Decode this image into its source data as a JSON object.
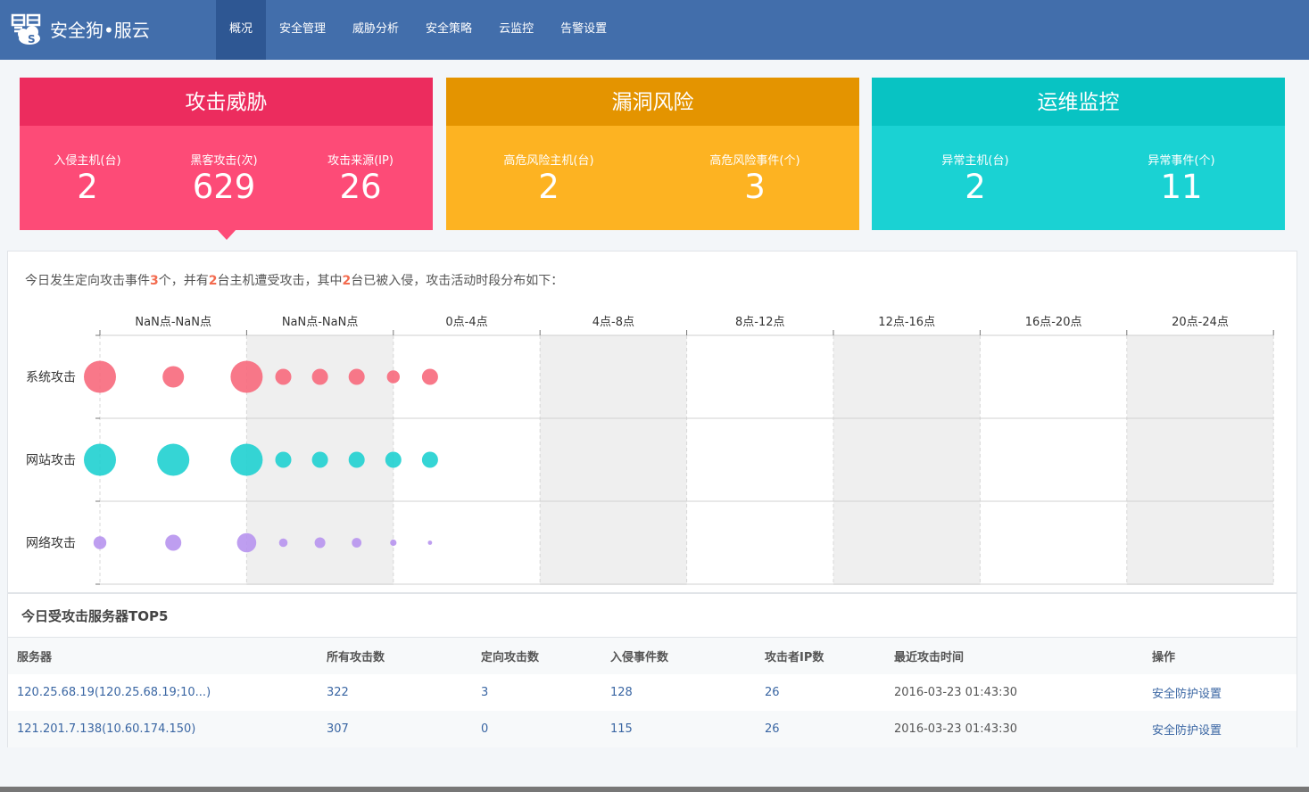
{
  "header": {
    "brand": "安全狗•服云",
    "logo_icon": "safedog-logo-icon",
    "nav": [
      {
        "label": "概况",
        "active": true
      },
      {
        "label": "安全管理",
        "active": false
      },
      {
        "label": "威胁分析",
        "active": false
      },
      {
        "label": "安全策略",
        "active": false
      },
      {
        "label": "云监控",
        "active": false
      },
      {
        "label": "告警设置",
        "active": false
      }
    ]
  },
  "cards": {
    "attack": {
      "title": "攻击威胁",
      "metrics": [
        {
          "label": "入侵主机(台)",
          "value": "2"
        },
        {
          "label": "黑客攻击(次)",
          "value": "629"
        },
        {
          "label": "攻击来源(IP)",
          "value": "26"
        }
      ]
    },
    "vuln": {
      "title": "漏洞风险",
      "metrics": [
        {
          "label": "高危风险主机(台)",
          "value": "2"
        },
        {
          "label": "高危风险事件(个)",
          "value": "3"
        }
      ]
    },
    "ops": {
      "title": "运维监控",
      "metrics": [
        {
          "label": "异常主机(台)",
          "value": "2"
        },
        {
          "label": "异常事件(个)",
          "value": "11"
        }
      ]
    }
  },
  "summary": {
    "p1": "今日发生定向攻击事件",
    "n1": "3",
    "p2": "个，并有",
    "n2": "2",
    "p3": "台主机遭受攻击，其中",
    "n3": "2",
    "p4": "台已被入侵，攻击活动时段分布如下："
  },
  "chart_data": {
    "type": "scatter",
    "columns": [
      "NaN点-NaN点",
      "NaN点-NaN点",
      "0点-4点",
      "4点-8点",
      "8点-12点",
      "12点-16点",
      "16点-20点",
      "20点-24点"
    ],
    "rows": [
      "系统攻击",
      "网站攻击",
      "网络攻击"
    ],
    "colors": {
      "系统攻击": "#f7697c",
      "网站攻击": "#1fd0d0",
      "网络攻击": "#b794ee"
    },
    "series": [
      {
        "name": "系统攻击",
        "x": [
          0,
          0.5,
          1,
          1.25,
          1.5,
          1.75,
          2,
          2.25
        ],
        "sizes": [
          3,
          2,
          3,
          1.5,
          1.5,
          1.5,
          1.2,
          1.5
        ]
      },
      {
        "name": "网站攻击",
        "x": [
          0,
          0.5,
          1,
          1.25,
          1.5,
          1.75,
          2,
          2.25
        ],
        "sizes": [
          3,
          3,
          3,
          1.5,
          1.5,
          1.5,
          1.5,
          1.5
        ]
      },
      {
        "name": "网络攻击",
        "x": [
          0,
          0.5,
          1,
          1.25,
          1.5,
          1.75,
          2,
          2.25
        ],
        "sizes": [
          1.2,
          1.5,
          1.8,
          0.8,
          1,
          0.9,
          0.6,
          0.4
        ]
      }
    ],
    "shaded_columns": [
      1,
      3,
      5,
      7
    ],
    "grid": true
  },
  "table": {
    "title": "今日受攻击服务器TOP5",
    "columns": [
      "服务器",
      "所有攻击数",
      "定向攻击数",
      "入侵事件数",
      "攻击者IP数",
      "最近攻击时间",
      "操作"
    ],
    "rows": [
      [
        "120.25.68.19(120.25.68.19;10...)",
        "322",
        "3",
        "128",
        "26",
        "2016-03-23 01:43:30",
        "安全防护设置"
      ],
      [
        "121.201.7.138(10.60.174.150)",
        "307",
        "0",
        "115",
        "26",
        "2016-03-23 01:43:30",
        "安全防护设置"
      ]
    ]
  }
}
